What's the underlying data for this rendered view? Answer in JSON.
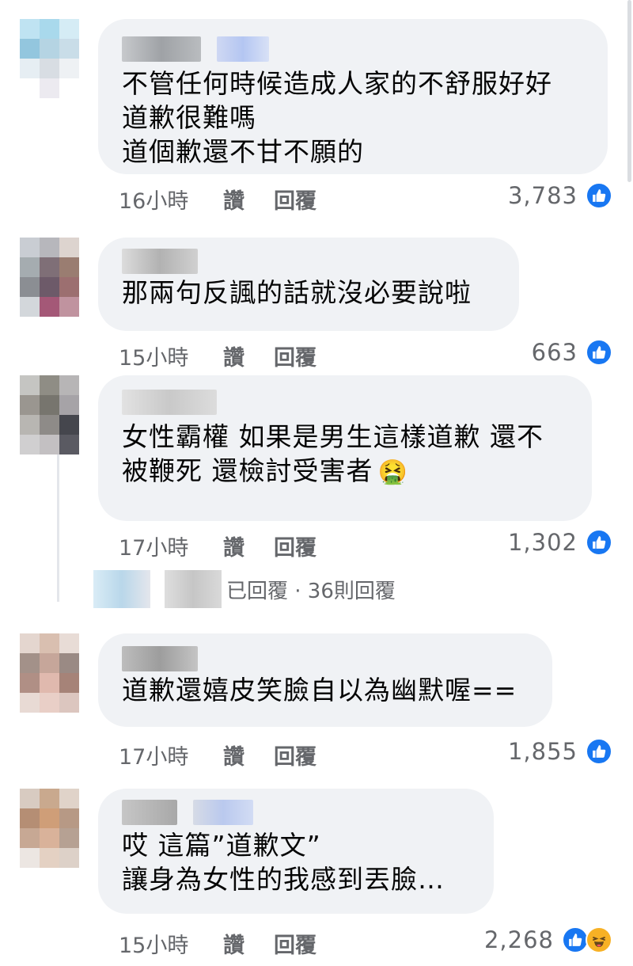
{
  "labels": {
    "like": "讚",
    "reply": "回覆"
  },
  "comments": [
    {
      "text": "不管任何時候造成人家的不舒服好好\n道歉很難嗎\n道個歉還不甘不願的",
      "time": "16小時",
      "count": "3,783",
      "reactions": [
        "like-icon"
      ]
    },
    {
      "text": "那兩句反諷的話就沒必要說啦",
      "time": "15小時",
      "count": "663",
      "reactions": [
        "like-icon"
      ]
    },
    {
      "text": "女性霸權 如果是男生這樣道歉 還不\n被鞭死 還檢討受害者",
      "emoji": "🤮",
      "time": "17小時",
      "count": "1,302",
      "reactions": [
        "like-icon"
      ]
    },
    {
      "text": "道歉還嬉皮笑臉自以為幽默喔==",
      "time": "17小時",
      "count": "1,855",
      "reactions": [
        "like-icon"
      ]
    },
    {
      "text": "哎 這篇”道歉文”\n讓身為女性的我感到丟臉…",
      "time": "15小時",
      "count": "2,268",
      "reactions": [
        "like-icon",
        "haha-icon"
      ]
    }
  ],
  "replies_summary": "已回覆 · 36則回覆",
  "colors": {
    "bubble": "#f0f2f5",
    "meta": "#65676b",
    "like": "#1877f2",
    "haha": "#f7b125"
  }
}
